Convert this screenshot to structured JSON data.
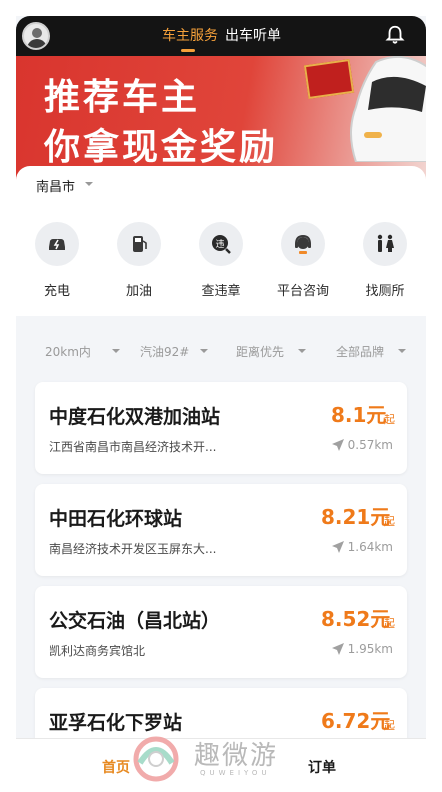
{
  "header": {
    "tabs": [
      {
        "label": "车主服务",
        "active": true
      },
      {
        "label": "出车听单",
        "active": false
      }
    ],
    "accent": "#f5a03a"
  },
  "banner": {
    "line1": "推荐车主",
    "line2": "你拿现金奖励"
  },
  "location": {
    "city": "南昌市"
  },
  "services": [
    {
      "label": "充电",
      "icon": "charging-car-icon"
    },
    {
      "label": "加油",
      "icon": "fuel-pump-icon"
    },
    {
      "label": "查违章",
      "icon": "violation-check-icon"
    },
    {
      "label": "平台咨询",
      "icon": "customer-service-icon"
    },
    {
      "label": "找厕所",
      "icon": "restroom-icon"
    }
  ],
  "filters": [
    {
      "label": "20km内"
    },
    {
      "label": "汽油92#"
    },
    {
      "label": "距离优先"
    },
    {
      "label": "全部品牌"
    }
  ],
  "stations": [
    {
      "name": "中度石化双港加油站",
      "address": "江西省南昌市南昌经济技术开...",
      "price": "8.1元",
      "price_suffix": "起",
      "distance": "0.57km"
    },
    {
      "name": "中田石化环球站",
      "address": "南昌经济技术开发区玉屏东大...",
      "price": "8.21元",
      "price_suffix": "起",
      "distance": "1.64km"
    },
    {
      "name": "公交石油（昌北站）",
      "address": "凯利达商务宾馆北",
      "price": "8.52元",
      "price_suffix": "起",
      "distance": "1.95km"
    },
    {
      "name": "亚孚石化下罗站",
      "address": "",
      "price": "6.72元",
      "price_suffix": "起",
      "distance": ""
    }
  ],
  "bottom_nav": {
    "home": "首页",
    "orders": "订单"
  },
  "watermark": {
    "text": "趣微游",
    "sub": "QUWEIYOU"
  },
  "colors": {
    "price": "#ef7a1a",
    "banner": "#d9352e"
  }
}
